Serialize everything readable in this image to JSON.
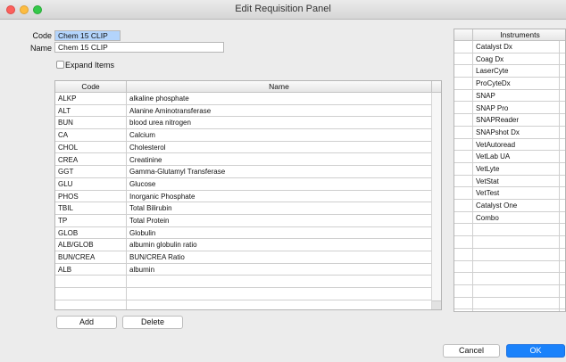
{
  "window": {
    "title": "Edit Requisition Panel"
  },
  "form": {
    "code_label": "Code",
    "code_value": "Chem 15 CLIP",
    "name_label": "Name",
    "name_value": "Chem 15 CLIP",
    "expand_label": "Expand Items",
    "expand_checked": false
  },
  "items_table": {
    "columns": [
      "Code",
      "Name"
    ],
    "rows": [
      [
        "ALKP",
        "alkaline phosphate"
      ],
      [
        "ALT",
        "Alanine Aminotransferase"
      ],
      [
        "BUN",
        "blood urea nitrogen"
      ],
      [
        "CA",
        "Calcium"
      ],
      [
        "CHOL",
        "Cholesterol"
      ],
      [
        "CREA",
        "Creatinine"
      ],
      [
        "GGT",
        "Gamma-Glutamyl Transferase"
      ],
      [
        "GLU",
        "Glucose"
      ],
      [
        "PHOS",
        "Inorganic Phosphate"
      ],
      [
        "TBIL",
        "Total Bilirubin"
      ],
      [
        "TP",
        "Total Protein"
      ],
      [
        "GLOB",
        "Globulin"
      ],
      [
        "ALB/GLOB",
        "albumin globulin ratio"
      ],
      [
        "BUN/CREA",
        "BUN/CREA Ratio"
      ],
      [
        "ALB",
        "albumin"
      ],
      [
        "",
        ""
      ],
      [
        "",
        ""
      ]
    ]
  },
  "instruments_table": {
    "header": "Instruments",
    "rows": [
      "Catalyst Dx",
      "Coag Dx",
      "LaserCyte",
      "ProCyteDx",
      "SNAP",
      "SNAP Pro",
      "SNAPReader",
      "SNAPshot Dx",
      "VetAutoread",
      "VetLab UA",
      "VetLyte",
      "VetStat",
      "VetTest",
      "Catalyst One",
      "Combo",
      "",
      "",
      "",
      "",
      "",
      "",
      "",
      "",
      ""
    ]
  },
  "buttons": {
    "add": "Add",
    "delete": "Delete",
    "cancel": "Cancel",
    "ok": "OK"
  },
  "colors": {
    "ok_button": "#1a82fb",
    "selection": "#b3d4fc",
    "close": "#fc605c",
    "minimize": "#fdbc40",
    "maximize": "#34c84a"
  }
}
